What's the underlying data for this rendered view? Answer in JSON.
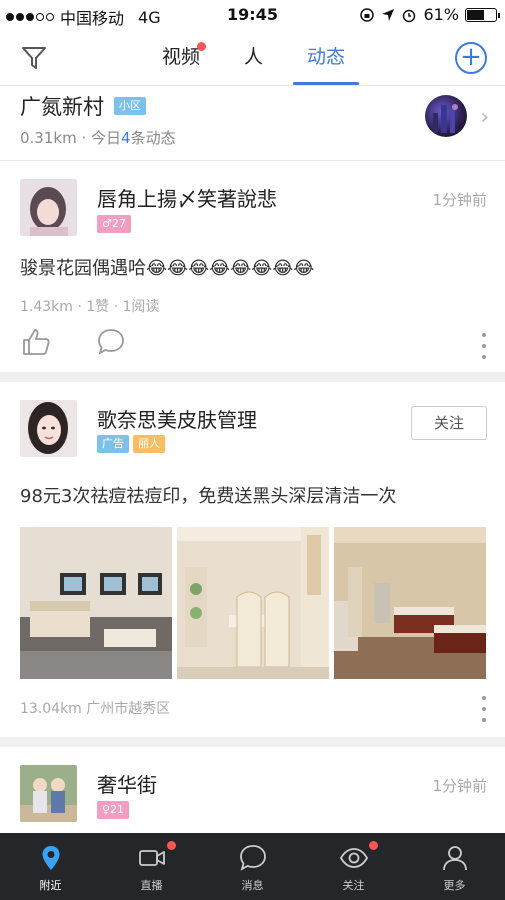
{
  "status_bar": {
    "carrier": "中国移动",
    "network": "4G",
    "time": "19:45",
    "battery": "61%",
    "battery_level": 0.61
  },
  "nav": {
    "tabs": [
      {
        "label": "视频",
        "badge": true
      },
      {
        "label": "人",
        "badge": false
      },
      {
        "label": "动态",
        "badge": false,
        "active": true
      }
    ]
  },
  "community": {
    "name": "广氮新村",
    "tag": "小区",
    "distance": "0.31km",
    "today_prefix": "· 今日",
    "today_count": "4",
    "today_suffix": "条动态"
  },
  "posts": [
    {
      "title": "唇角上揚〆笑著說悲",
      "time": "1分钟前",
      "level_badge": "♂27",
      "body": "骏景花园偶遇哈",
      "emoji": "😂😂😂😂😂😂😂😂",
      "footer": "1.43km · 1赞 · 1阅读"
    },
    {
      "title": "歌奈思美皮肤管理",
      "follow": "关注",
      "tags": [
        "广告",
        "丽人"
      ],
      "body": "98元3次祛痘祛痘印，免费送黑头深层清洁一次",
      "footer": "13.04km  广州市越秀区"
    },
    {
      "title": "奢华街",
      "time": "1分钟前",
      "level_badge": "♀21"
    }
  ],
  "bottom_bar": {
    "items": [
      {
        "label": "附近",
        "active": true
      },
      {
        "label": "直播",
        "badge": true
      },
      {
        "label": "消息"
      },
      {
        "label": "关注",
        "badge": true
      },
      {
        "label": "更多"
      }
    ]
  },
  "colors": {
    "accent": "#3f7bd6",
    "badge_red": "#f55555",
    "bottom_bar_bg": "#24262a"
  }
}
